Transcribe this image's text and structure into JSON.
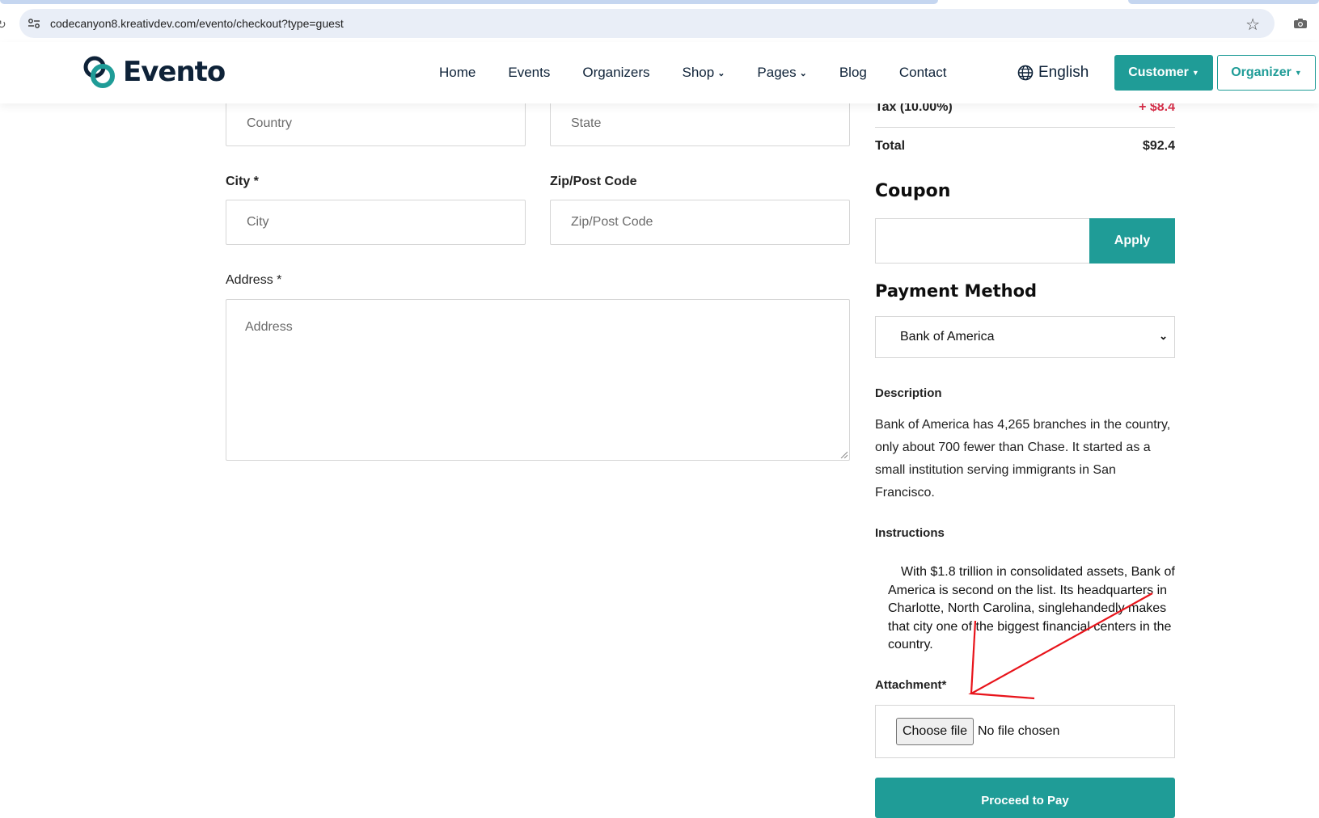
{
  "browser": {
    "url": "codecanyon8.kreativdev.com/evento/checkout?type=guest"
  },
  "header": {
    "brand": "Evento",
    "nav": [
      {
        "label": "Home",
        "dropdown": false
      },
      {
        "label": "Events",
        "dropdown": false
      },
      {
        "label": "Organizers",
        "dropdown": false
      },
      {
        "label": "Shop",
        "dropdown": true
      },
      {
        "label": "Pages",
        "dropdown": true
      },
      {
        "label": "Blog",
        "dropdown": false
      },
      {
        "label": "Contact",
        "dropdown": false
      }
    ],
    "language": "English",
    "customer_label": "Customer",
    "organizer_label": "Organizer"
  },
  "form": {
    "country_placeholder": "Country",
    "state_placeholder": "State",
    "city_label": "City *",
    "city_placeholder": "City",
    "zip_label": "Zip/Post Code",
    "zip_placeholder": "Zip/Post Code",
    "address_label": "Address *",
    "address_placeholder": "Address"
  },
  "summary": {
    "tax_label": "Tax (10.00%)",
    "tax_value": "+ $8.4",
    "total_label": "Total",
    "total_value": "$92.4"
  },
  "coupon": {
    "title": "Coupon",
    "value": "",
    "apply_label": "Apply"
  },
  "payment": {
    "title": "Payment Method",
    "selected": "Bank of America",
    "description_label": "Description",
    "description": "Bank of America has 4,265 branches in the country, only about 700 fewer than Chase. It started as a small institution serving immigrants in San Francisco.",
    "instructions_label": "Instructions",
    "instructions": "With $1.8 trillion in consolidated assets, Bank of America is second on the list. Its headquarters in Charlotte, North Carolina, singlehandedly makes that city one of the biggest financial centers in the country.",
    "attachment_label": "Attachment*",
    "choose_file_label": "Choose file",
    "file_status": "No file chosen",
    "proceed_label": "Proceed to Pay"
  },
  "colors": {
    "accent": "#1f9c97",
    "brand_dark": "#0e2238",
    "tax_red": "#d92f4a",
    "annotation_red": "#e8141b"
  },
  "icons": [
    "site-settings-icon",
    "star-icon",
    "camera-icon",
    "logo-icon",
    "globe-icon",
    "caret-down-icon",
    "chevron-down-icon",
    "resize-grip-icon"
  ]
}
